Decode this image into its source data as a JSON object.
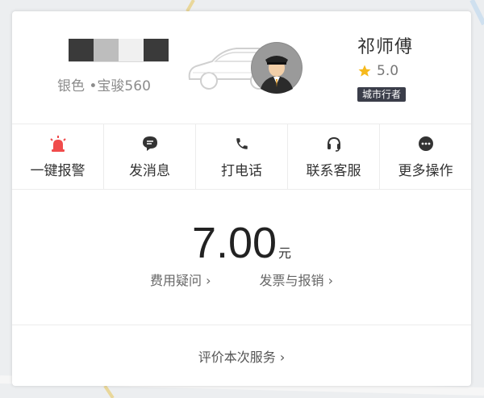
{
  "driver": {
    "car_info": "银色 •宝骏560",
    "name": "祁师傅",
    "rating": "5.0",
    "badge": "城市行者"
  },
  "actions": [
    {
      "label": "一键报警",
      "icon": "alarm-icon"
    },
    {
      "label": "发消息",
      "icon": "message-icon"
    },
    {
      "label": "打电话",
      "icon": "phone-icon"
    },
    {
      "label": "联系客服",
      "icon": "headset-icon"
    },
    {
      "label": "更多操作",
      "icon": "more-icon"
    }
  ],
  "fare": {
    "amount": "7.00",
    "unit": "元",
    "question_link": "费用疑问",
    "invoice_link": "发票与报销"
  },
  "rate_service": "评价本次服务",
  "colors": {
    "alarm": "#f04b4b",
    "star": "#f6b91c",
    "badge_bg": "#3b3e4a"
  }
}
